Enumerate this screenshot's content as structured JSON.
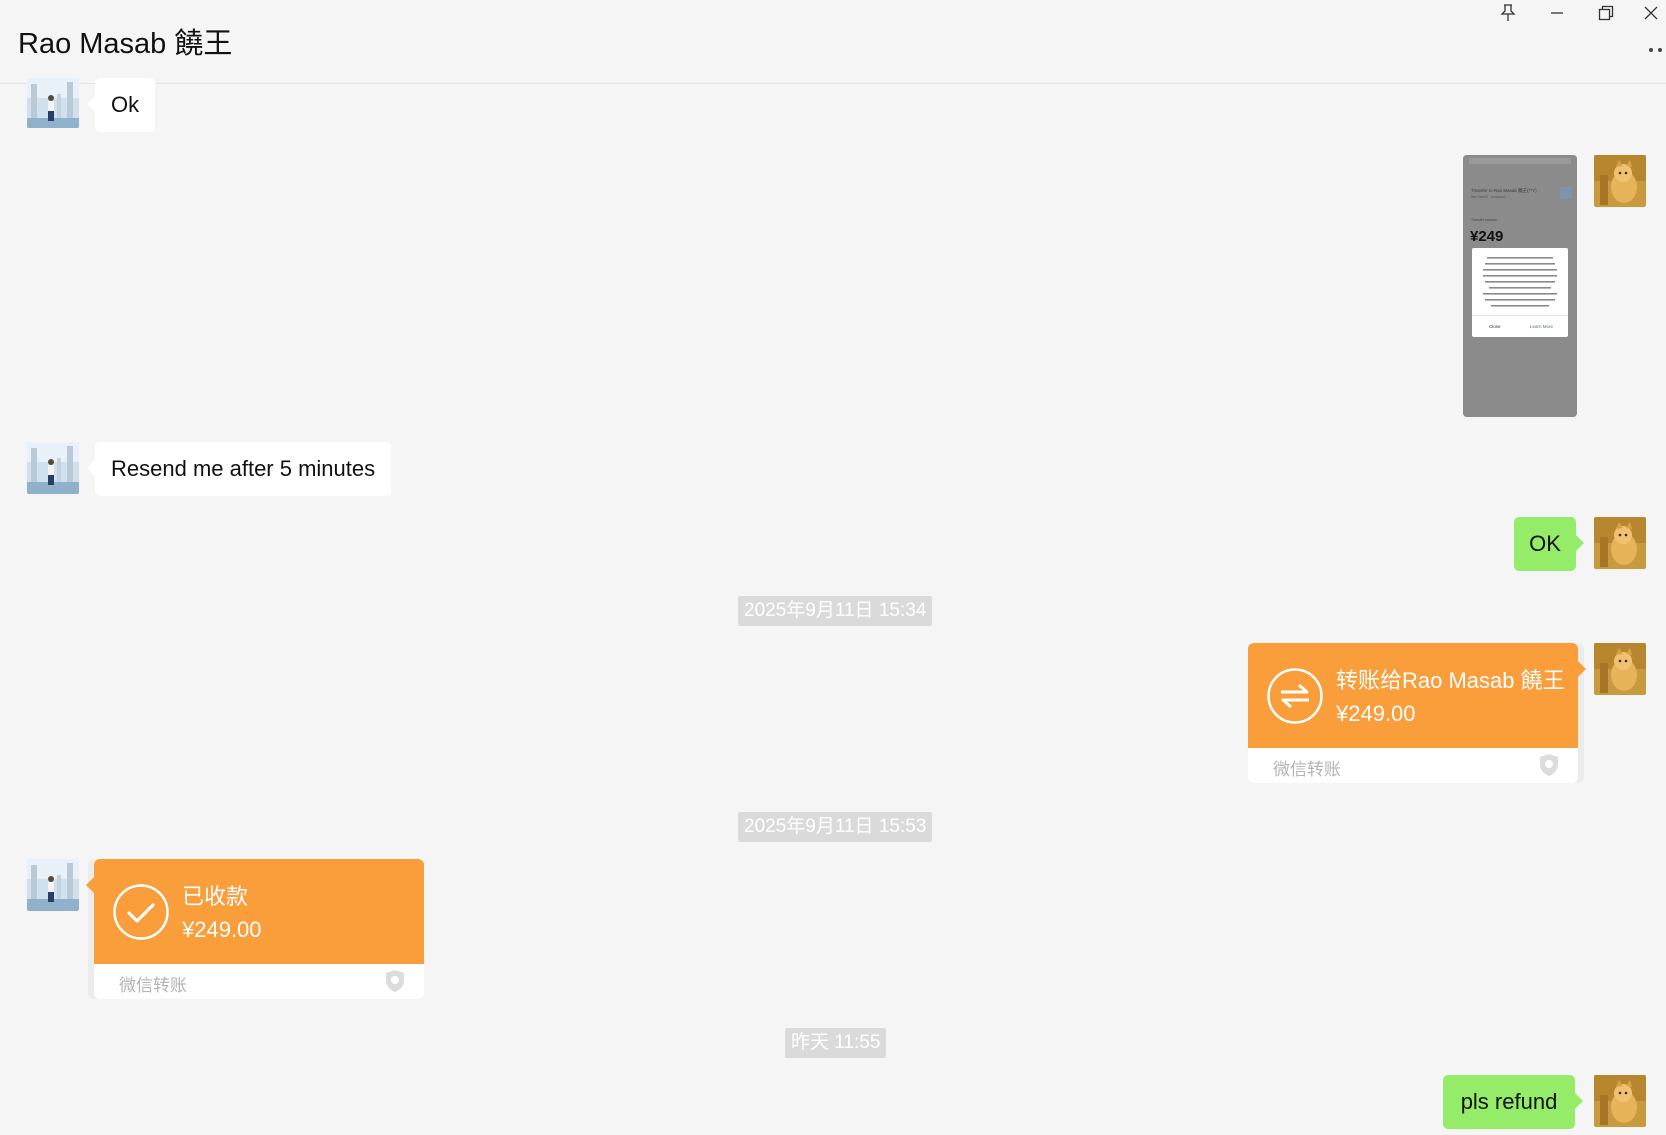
{
  "window": {
    "chat_title": "Rao Masab 饒王",
    "buttons": {
      "pin": "pin-icon",
      "minimize": "minimize-icon",
      "maximize": "restore-icon",
      "close": "close-icon",
      "more": "more-icon"
    }
  },
  "messages": {
    "msg1": {
      "text": "Ok"
    },
    "msg2": {
      "type": "image",
      "thumb": {
        "header": "Transfer to Rao Masab 饒王(**Y)",
        "subheader": "WeChat ID · (masked)",
        "amount_label": "Transfer amount",
        "amount": "¥249",
        "dialog_text": "Unable to make the payment because this transaction may contain fraud risk. To ensure the security of your funds, carefully verify the other user's identity. If you still want to make the payment after verification, initiate the payment after 5 minutes.",
        "close": "Close",
        "learn_more": "Learn More"
      }
    },
    "msg3": {
      "text": "Resend me after 5 minutes"
    },
    "msg4": {
      "text": "OK"
    },
    "ts1": {
      "text": "2025年9月11日 15:34"
    },
    "transfer_out": {
      "title": "转账给Rao Masab 饒王",
      "amount": "¥249.00",
      "footer": "微信转账"
    },
    "ts2": {
      "text": "2025年9月11日 15:53"
    },
    "transfer_in": {
      "title": "已收款",
      "amount": "¥249.00",
      "footer": "微信转账"
    },
    "ts3": {
      "text": "昨天 11:55"
    },
    "msg5": {
      "text": "pls refund"
    }
  },
  "colors": {
    "background": "#f5f5f5",
    "incoming_bubble": "#ffffff",
    "outgoing_bubble": "#95ec69",
    "transfer_orange": "#fa9d3b",
    "timestamp_bg": "#dadada"
  }
}
